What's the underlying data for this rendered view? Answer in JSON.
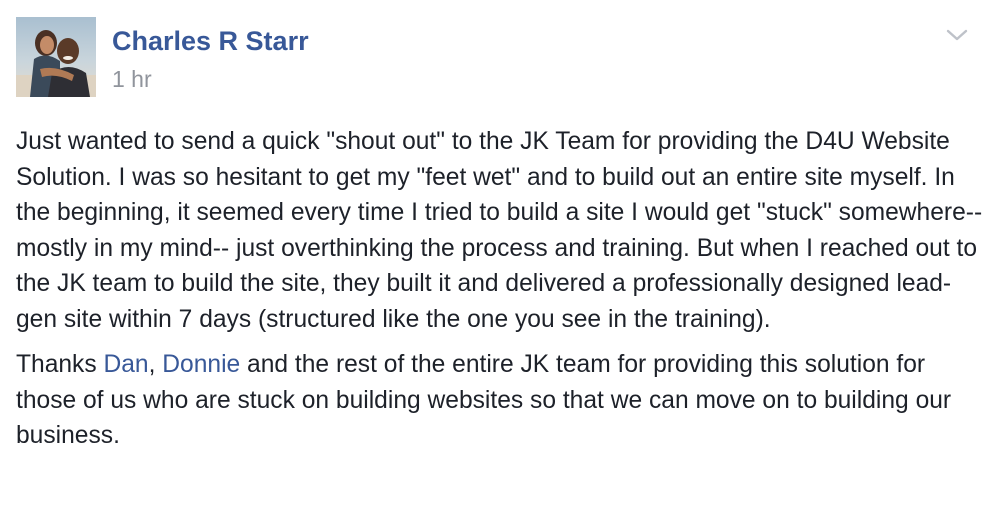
{
  "post": {
    "author": "Charles R Starr",
    "timestamp": "1 hr",
    "menu_icon": "chevron-down-icon",
    "avatar_icon": "profile-photo",
    "paragraph1": "Just wanted to send a quick \"shout out\" to the JK Team for providing the D4U Website Solution. I was so hesitant to get my \"feet wet\" and to build out an entire site myself. In the beginning, it seemed every time I tried to build a site I would get \"stuck\" somewhere-- mostly in my mind-- just overthinking the process and training. But when I reached out to the JK team to build the site, they built it and delivered a professionally designed lead-gen site within 7 days (structured like the one you see in the training).",
    "paragraph2": {
      "text_before": "Thanks ",
      "mention1": "Dan",
      "separator": ", ",
      "mention2": "Donnie",
      "text_after": " and the rest of the entire JK team for providing this solution for those of us who are stuck on building websites so that we can move on to building our business."
    }
  },
  "colors": {
    "link": "#385898",
    "text": "#1d2129",
    "meta": "#90949c",
    "chevron": "#bec2c9"
  }
}
